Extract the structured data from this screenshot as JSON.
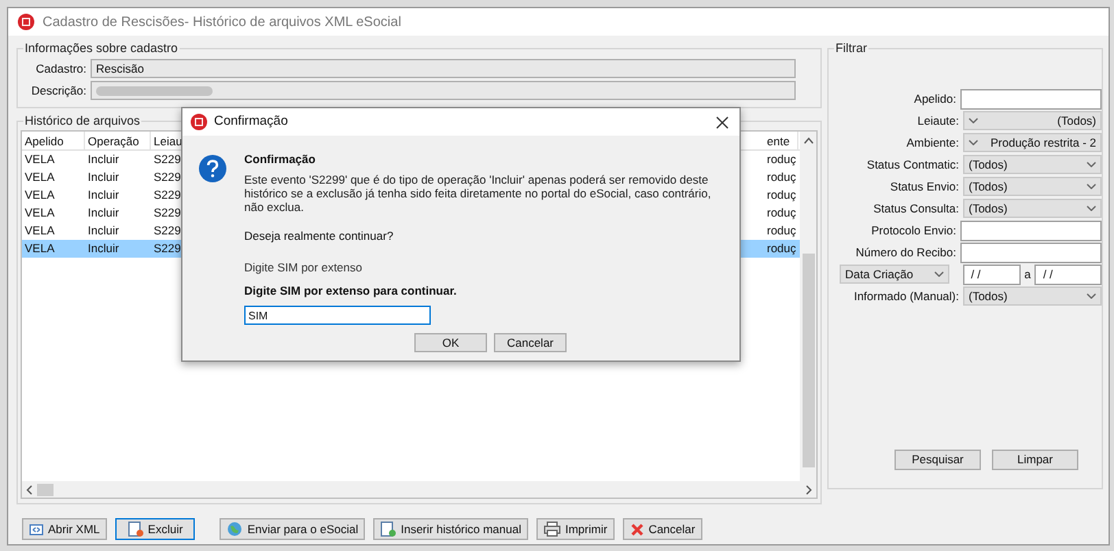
{
  "window": {
    "title": "Cadastro de Rescisões- Histórico de arquivos XML eSocial"
  },
  "info": {
    "legend": "Informações sobre cadastro",
    "fields": [
      {
        "label": "Cadastro:",
        "value": "Rescisão",
        "redacted": false
      },
      {
        "label": "Descrição:",
        "redacted": true
      }
    ]
  },
  "history": {
    "legend": "Histórico de arquivos",
    "columns": [
      "Apelido",
      "Operação",
      "Leiau",
      "ente"
    ],
    "rows": [
      {
        "cells": [
          "VELA",
          "Incluir",
          "S229",
          "roduç"
        ],
        "selected": false
      },
      {
        "cells": [
          "VELA",
          "Incluir",
          "S229",
          "roduç"
        ],
        "selected": false
      },
      {
        "cells": [
          "VELA",
          "Incluir",
          "S229",
          "roduç"
        ],
        "selected": false
      },
      {
        "cells": [
          "VELA",
          "Incluir",
          "S229",
          "roduç"
        ],
        "selected": false
      },
      {
        "cells": [
          "VELA",
          "Incluir",
          "S229",
          "roduç"
        ],
        "selected": false
      },
      {
        "cells": [
          "VELA",
          "Incluir",
          "S229",
          "roduç"
        ],
        "selected": true
      }
    ]
  },
  "buttons": [
    {
      "label": "Abrir XML",
      "kind": "xml",
      "focused": false
    },
    {
      "label": "Excluir",
      "kind": "delete",
      "focused": true
    },
    {
      "label": "Enviar para o eSocial",
      "kind": "send",
      "focused": false
    },
    {
      "label": "Inserir histórico manual",
      "kind": "insert",
      "focused": false
    },
    {
      "label": "Imprimir",
      "kind": "print",
      "focused": false
    },
    {
      "label": "Cancelar",
      "kind": "cancel",
      "focused": false
    }
  ],
  "filter": {
    "legend": "Filtrar",
    "fields": [
      {
        "kind": "text",
        "label": "Apelido:"
      },
      {
        "kind": "locked_select",
        "label": "Leiaute:",
        "value": "(Todos)"
      },
      {
        "kind": "locked_select",
        "label": "Ambiente:",
        "value": "Produção restrita - 2"
      },
      {
        "kind": "select",
        "label": "Status Contmatic:",
        "value": "(Todos)"
      },
      {
        "kind": "select",
        "label": "Status Envio:",
        "value": "(Todos)"
      },
      {
        "kind": "select",
        "label": "Status Consulta:",
        "value": "(Todos)"
      },
      {
        "kind": "text",
        "label": "Protocolo Envio:"
      },
      {
        "kind": "text",
        "label": "Número do Recibo:"
      },
      {
        "kind": "date_range",
        "select": "Data Criação",
        "from": "/ /",
        "separator": "a",
        "to": "/ /"
      },
      {
        "kind": "select",
        "label": "Informado (Manual):",
        "value": "(Todos)"
      }
    ],
    "buttons": [
      "Pesquisar",
      "Limpar"
    ]
  },
  "dialog": {
    "title": "Confirmação",
    "heading": "Confirmação",
    "message": "Este evento 'S2299' que é do tipo de operação 'Incluir' apenas poderá ser removido deste histórico se a exclusão já tenha sido feita diretamente no portal do eSocial, caso contrário, não exclua.",
    "question": "Deseja realmente continuar?",
    "hint": "Digite SIM por extenso",
    "prompt": "Digite SIM por extenso para continuar.",
    "input": "SIM",
    "buttons": [
      "OK",
      "Cancelar"
    ]
  }
}
